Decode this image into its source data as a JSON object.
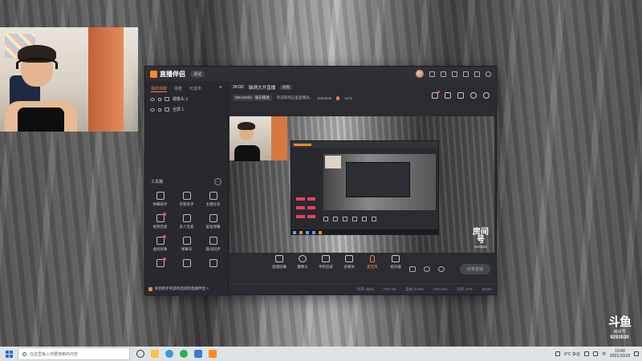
{
  "app": {
    "name": "直播伴侣",
    "version_badge": "测试",
    "left_tabs": [
      "我的场景",
      "场景",
      "可发布"
    ],
    "add_label": "+",
    "sources": [
      {
        "label": "摄像头 1"
      },
      {
        "label": "全屏 1"
      }
    ],
    "toolbox": {
      "title": "工具箱",
      "more": "···",
      "items": [
        {
          "label": "弹幕助手",
          "icon": "danmu-icon",
          "dot": false
        },
        {
          "label": "房管助手",
          "icon": "user-manager-icon",
          "dot": false
        },
        {
          "label": "主播任务",
          "icon": "task-icon",
          "dot": false
        },
        {
          "label": "视频连麦",
          "icon": "video-link-icon",
          "dot": true
        },
        {
          "label": "多人连麦",
          "icon": "multi-link-icon",
          "dot": false
        },
        {
          "label": "鲨鱼弹幕",
          "icon": "shark-icon",
          "dot": false
        },
        {
          "label": "虚拟形象",
          "icon": "avatar-icon",
          "dot": true
        },
        {
          "label": "弹幕号",
          "icon": "robot-icon",
          "dot": false
        },
        {
          "label": "歌词同步",
          "icon": "lyrics-icon",
          "dot": false
        },
        {
          "label": "",
          "icon": "film-icon",
          "dot": true
        },
        {
          "label": "",
          "icon": "clock-icon",
          "dot": false
        },
        {
          "label": "",
          "icon": "plug-icon",
          "dot": false
        }
      ]
    },
    "tip_text": "如何把手机游戏连接到直播伴侣 >",
    "room": {
      "title": "2K0l2",
      "subtitle": "脑洞大开直播",
      "tag": "观看",
      "category": "NBA2K0l2 · 娱乐播放",
      "announce": "欢迎来到这里直播间。",
      "room_id": "9293030",
      "popularity": "1172"
    },
    "controls": [
      {
        "label": "直播屏幕",
        "icon": "screen-icon",
        "shape": "square",
        "accent": false
      },
      {
        "label": "摄像头",
        "icon": "camera-icon",
        "shape": "circle",
        "accent": false
      },
      {
        "label": "手机投屏",
        "icon": "phone-cast-icon",
        "shape": "square",
        "accent": false
      },
      {
        "label": "多媒体",
        "icon": "media-icon",
        "shape": "square",
        "accent": false
      },
      {
        "label": "麦克风",
        "icon": "mic-icon",
        "shape": "mic",
        "accent": true
      },
      {
        "label": "扬声器",
        "icon": "speaker-icon",
        "shape": "square",
        "accent": false
      }
    ],
    "live_button": "结束直播",
    "status": [
      "码率 0kb/s",
      "FPS 60",
      "丢帧 0.00%",
      "CPU 4%",
      "内存 17%",
      "00:00"
    ],
    "preview_room_label": "房间号",
    "preview_room_id": "9293030"
  },
  "watermark": {
    "logo": "斗鱼",
    "sub": "房间号",
    "room_id": "9293030"
  },
  "taskbar": {
    "search_placeholder": "在这里输入你要搜索的内容",
    "weather": "9°C 多云",
    "lang": "中",
    "time": "19:40",
    "date": "2021/10/18"
  },
  "colors": {
    "accent": "#ff8a1d",
    "live_accent": "#ff7d47",
    "window_bg": "#2b2c31"
  }
}
